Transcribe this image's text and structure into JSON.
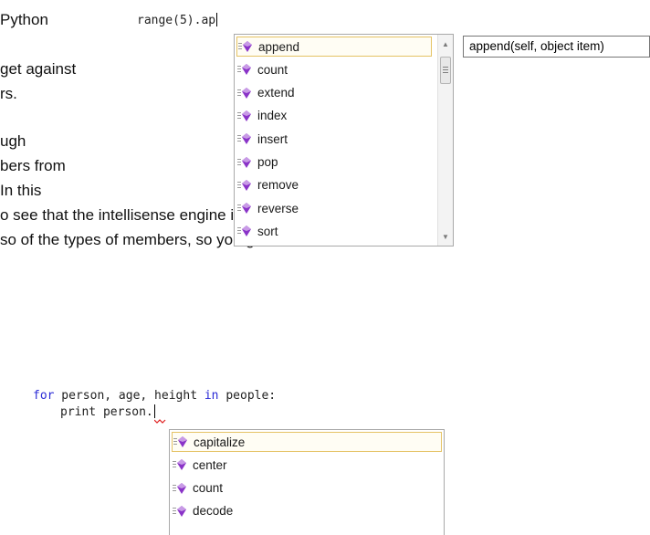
{
  "doc_text": {
    "line1": "Python",
    "line2": "get against",
    "line3": "rs.",
    "line4": "ugh",
    "line5": "bers from",
    "line6": "In this",
    "line7": "o see that the intellisense engine is aware of",
    "line8": "so of the types of members, so you get a"
  },
  "example1": {
    "code": "range(5).ap",
    "completion_items": [
      "append",
      "count",
      "extend",
      "index",
      "insert",
      "pop",
      "remove",
      "reverse",
      "sort"
    ],
    "selected_item": "append",
    "tooltip": "append(self, object item)"
  },
  "example2": {
    "code_line1": {
      "kw_for": "for",
      "vars": " person, age, height ",
      "kw_in": "in",
      "rest": " people:"
    },
    "code_line2": "print person.",
    "completion_items": [
      "capitalize",
      "center",
      "count",
      "decode"
    ],
    "selected_item": "capitalize"
  },
  "icons": {
    "member": "method-icon"
  },
  "colors": {
    "keyword": "#2b2bd6",
    "selection_border": "#e5c365",
    "method_icon": "#8a33c8"
  }
}
